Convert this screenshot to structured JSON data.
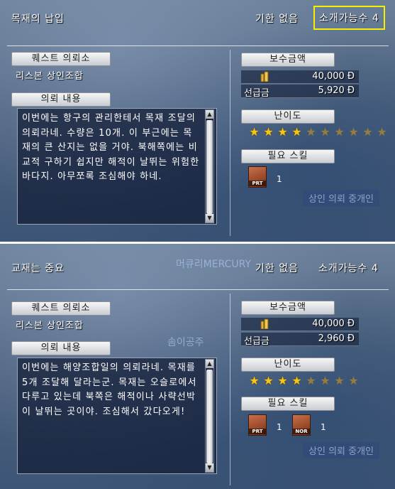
{
  "top": {
    "title": "목재의 납입",
    "deadline": "기한 없음",
    "intro_label": "소개가능수 4",
    "client_tab": "퀘스트 의뢰소",
    "client_name": "리스본 상인조합",
    "request_tab": "의뢰 내용",
    "request_text": "이번에는 항구의 관리한테서 목재 조달의 의뢰라네. 수량은 10개. 이 부근에는 목재의 큰 산지는 없을 거야. 북해쪽에는 비교적 구하기 쉽지만 해적이 날뛰는 위험한 바다지. 아무쪼록 조심해야 하네.",
    "reward_tab": "보수금액",
    "reward_value": "40,000 Ð",
    "advance_label": "선급금",
    "advance_value": "5,920 Ð",
    "difficulty_tab": "난이도",
    "difficulty": 4,
    "difficulty_max": 10,
    "skills_tab": "필요 스킬",
    "skills": [
      {
        "code": "PRT",
        "level": "1",
        "icon": "book-red-icon"
      }
    ],
    "bg_button": "상인 의뢰 중개인"
  },
  "bottom": {
    "title": "교재는 중요",
    "deadline": "기한 없음",
    "intro_label": "소개가능수 4",
    "client_tab": "퀘스트 의뢰소",
    "client_name": "리스본 상인조합",
    "request_tab": "의뢰 내용",
    "request_text": "이번에는 해양조합일의 의뢰라네. 목재를 5개 조달해 달라는군. 목재는 오슬로에서 다루고 있는데 북쪽은 해적이나 사략선박이 날뛰는 곳이야. 조심해서 갔다오게!",
    "reward_tab": "보수금액",
    "reward_value": "40,000 Ð",
    "advance_label": "선급금",
    "advance_value": "2,960 Ð",
    "difficulty_tab": "난이도",
    "difficulty": 4,
    "difficulty_max": 8,
    "skills_tab": "필요 스킬",
    "skills": [
      {
        "code": "PRT",
        "level": "1",
        "icon": "book-red-icon"
      },
      {
        "code": "NOR",
        "level": "1",
        "icon": "book-red-icon"
      }
    ],
    "bg_button": "상인 의뢰 중개인",
    "bg_names": [
      "머큐리MERCURY",
      "솜이공주"
    ]
  },
  "colors": {
    "highlight_box": "#f4f000",
    "star_on": "#f5c518"
  }
}
